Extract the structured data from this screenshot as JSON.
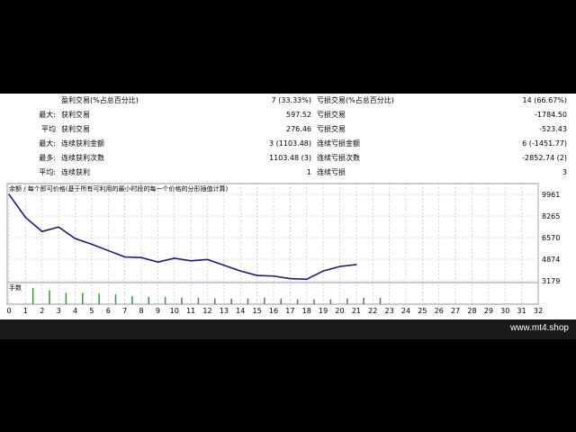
{
  "stats": {
    "rows": [
      {
        "l1": "",
        "k1": "盈利交易(%占总百分比)",
        "v1": "7 (33.33%)",
        "k2": "亏损交易(%占总百分比)",
        "v2": "14 (66.67%)"
      },
      {
        "l1": "最大:",
        "k1": "获利交易",
        "v1": "597.52",
        "k2": "亏损交易",
        "v2": "-1784.50"
      },
      {
        "l1": "平均",
        "k1": "获利交易",
        "v1": "276.46",
        "k2": "亏损交易",
        "v2": "-523.43"
      },
      {
        "l1": "最大:",
        "k1": "连续获利金额",
        "v1": "3 (1103.48)",
        "k2": "连续亏损金额",
        "v2": "6 (-1451.77)"
      },
      {
        "l1": "最多:",
        "k1": "连续获利次数",
        "v1": "1103.48 (3)",
        "k2": "连续亏损次数",
        "v2": "-2852.74 (2)"
      },
      {
        "l1": "平均:",
        "k1": "连续获利",
        "v1": "1",
        "k2": "连续亏损",
        "v2": "3"
      }
    ]
  },
  "chart_data": {
    "type": "line",
    "title": "余额 / 每个即可价格(基于所有可利用的最小时段的每一个价格的分形插值计算)",
    "volume_label": "手数",
    "y_ticks": [
      "9961",
      "8265",
      "6570",
      "4874",
      "3179"
    ],
    "x_ticks": [
      "0",
      "1",
      "2",
      "3",
      "4",
      "5",
      "6",
      "7",
      "8",
      "9",
      "10",
      "11",
      "12",
      "13",
      "14",
      "15",
      "16",
      "17",
      "18",
      "19",
      "20",
      "21",
      "22",
      "23",
      "24",
      "25",
      "26",
      "27",
      "28",
      "29",
      "30",
      "31",
      "32"
    ],
    "ylim": [
      3179,
      9961
    ],
    "xlim": [
      0,
      32
    ],
    "balance": [
      [
        0,
        9961
      ],
      [
        1,
        8150
      ],
      [
        2,
        7050
      ],
      [
        3,
        7400
      ],
      [
        4,
        6500
      ],
      [
        5,
        6050
      ],
      [
        6,
        5550
      ],
      [
        7,
        5050
      ],
      [
        8,
        5000
      ],
      [
        9,
        4650
      ],
      [
        10,
        4950
      ],
      [
        11,
        4750
      ],
      [
        12,
        4850
      ],
      [
        13,
        4400
      ],
      [
        14,
        3950
      ],
      [
        15,
        3600
      ],
      [
        16,
        3550
      ],
      [
        17,
        3350
      ],
      [
        18,
        3300
      ],
      [
        19,
        3950
      ],
      [
        20,
        4300
      ],
      [
        21,
        4450
      ]
    ],
    "volume": [
      {
        "x": 1,
        "v": 1.0
      },
      {
        "x": 2,
        "v": 0.85
      },
      {
        "x": 3,
        "v": 0.7
      },
      {
        "x": 4,
        "v": 0.7
      },
      {
        "x": 5,
        "v": 0.65
      },
      {
        "x": 6,
        "v": 0.6
      },
      {
        "x": 7,
        "v": 0.5
      },
      {
        "x": 8,
        "v": 0.45
      },
      {
        "x": 9,
        "v": 0.45
      },
      {
        "x": 10,
        "v": 0.4
      },
      {
        "x": 11,
        "v": 0.4
      },
      {
        "x": 12,
        "v": 0.35
      },
      {
        "x": 13,
        "v": 0.35
      },
      {
        "x": 14,
        "v": 0.35
      },
      {
        "x": 15,
        "v": 0.4
      },
      {
        "x": 16,
        "v": 0.35
      },
      {
        "x": 17,
        "v": 0.3
      },
      {
        "x": 18,
        "v": 0.3
      },
      {
        "x": 19,
        "v": 0.3
      },
      {
        "x": 20,
        "v": 0.35
      },
      {
        "x": 21,
        "v": 0.4
      },
      {
        "x": 22,
        "v": 0.4
      }
    ],
    "colors": {
      "balance": "#1a1a80",
      "volume": "#2e9e2e",
      "grid": "#bbbbbb"
    }
  },
  "brand": {
    "text": "www.mt4.shop"
  }
}
